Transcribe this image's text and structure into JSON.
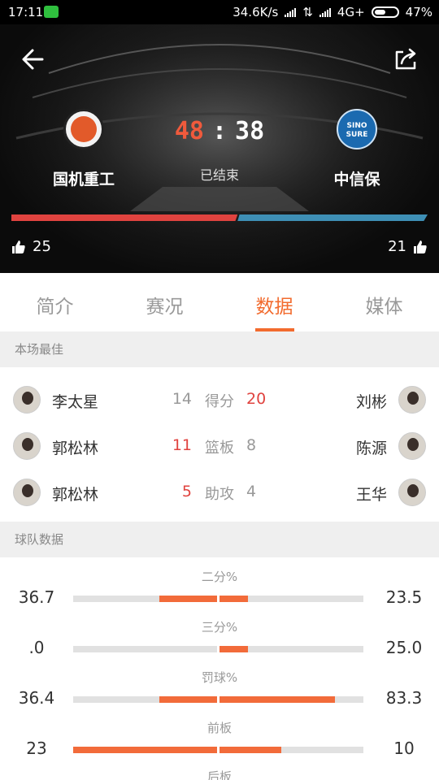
{
  "status_bar": {
    "time": "17:11",
    "net_speed": "34.6K/s",
    "network": "4G+",
    "battery": "47%"
  },
  "game": {
    "home": {
      "name": "国机重工",
      "score": "48",
      "likes": "25"
    },
    "away": {
      "name": "中信保",
      "score": "38",
      "likes": "21"
    },
    "separator": ":",
    "status": "已结束",
    "away_logo_text": "SINO SURE",
    "colors": {
      "home_bar": "#e0433f",
      "away_bar": "#3e8fb5",
      "accent": "#f26b2e"
    }
  },
  "tabs": [
    {
      "label": "简介",
      "active": false
    },
    {
      "label": "赛况",
      "active": false
    },
    {
      "label": "数据",
      "active": true
    },
    {
      "label": "媒体",
      "active": false
    }
  ],
  "best": {
    "title": "本场最佳",
    "rows": [
      {
        "label": "得分",
        "left_name": "李太星",
        "left_value": "14",
        "right_value": "20",
        "right_name": "刘彬",
        "leader": "right"
      },
      {
        "label": "篮板",
        "left_name": "郭松林",
        "left_value": "11",
        "right_value": "8",
        "right_name": "陈源",
        "leader": "left"
      },
      {
        "label": "助攻",
        "left_name": "郭松林",
        "left_value": "5",
        "right_value": "4",
        "right_name": "王华",
        "leader": "left"
      }
    ]
  },
  "team_stats": {
    "title": "球队数据",
    "rows": [
      {
        "label": "二分%",
        "left": "36.7",
        "right": "23.5",
        "left_fill": 0.4,
        "right_fill": 0.2
      },
      {
        "label": "三分%",
        "left": ".0",
        "right": "25.0",
        "left_fill": 0.0,
        "right_fill": 0.2
      },
      {
        "label": "罚球%",
        "left": "36.4",
        "right": "83.3",
        "left_fill": 0.4,
        "right_fill": 0.8
      },
      {
        "label": "前板",
        "left": "23",
        "right": "10",
        "left_fill": 1.0,
        "right_fill": 0.43
      },
      {
        "label": "后板",
        "left": "",
        "right": "",
        "left_fill": 0.0,
        "right_fill": 0.0
      }
    ]
  }
}
